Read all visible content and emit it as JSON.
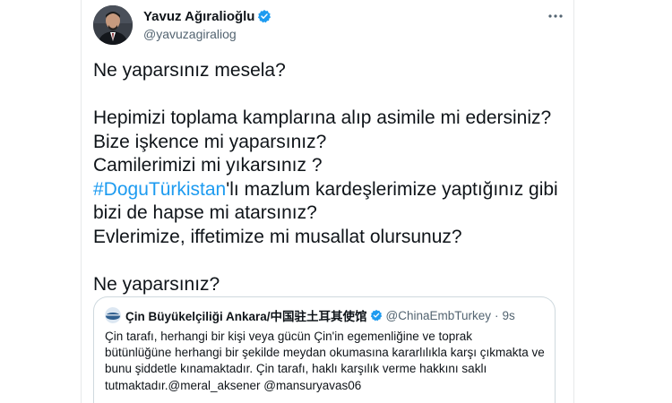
{
  "author": {
    "display_name": "Yavuz Ağıralioğlu",
    "handle": "@yavuzagiraliog",
    "verified": true
  },
  "tweet": {
    "lines": [
      "Ne yaparsınız mesela?",
      "",
      "Hepimizi toplama kamplarına alıp asimile mi edersiniz?",
      "Bize işkence mi yaparsınız?",
      "Camilerimizi mi yıkarsınız ?",
      {
        "hashtag": "#DoguTürkistan",
        "rest": "'lı mazlum kardeşlerimize yaptığınız gibi"
      },
      "bizi de hapse mi atarsınız?",
      "Evlerimize, iffetimize mi musallat olursunuz?",
      "",
      "Ne yaparsınız?"
    ]
  },
  "quoted_tweet": {
    "display_name": "Çin Büyükelçiliği Ankara/中国驻土耳其使馆",
    "handle": "@ChinaEmbTurkey",
    "separator": "·",
    "time": "9s",
    "verified": true,
    "lines": [
      "Çin tarafı, herhangi bir kişi veya gücün Çin'in egemenliğine ve toprak",
      "bütünlüğüne herhangi bir şekilde meydan okumasına kararlılıkla karşı çıkmakta ve",
      "bunu şiddetle kınamaktadır. Çin tarafı, haklı karşılık verme hakkını saklı",
      "tutmaktadır.@meral_aksener @mansuryavas06"
    ]
  },
  "colors": {
    "accent": "#1d9bf0",
    "text": "#0f1419",
    "secondary": "#536471",
    "border": "#cfd9de"
  },
  "icons": {
    "verified": "verified-badge-icon",
    "more": "more-options-icon"
  }
}
